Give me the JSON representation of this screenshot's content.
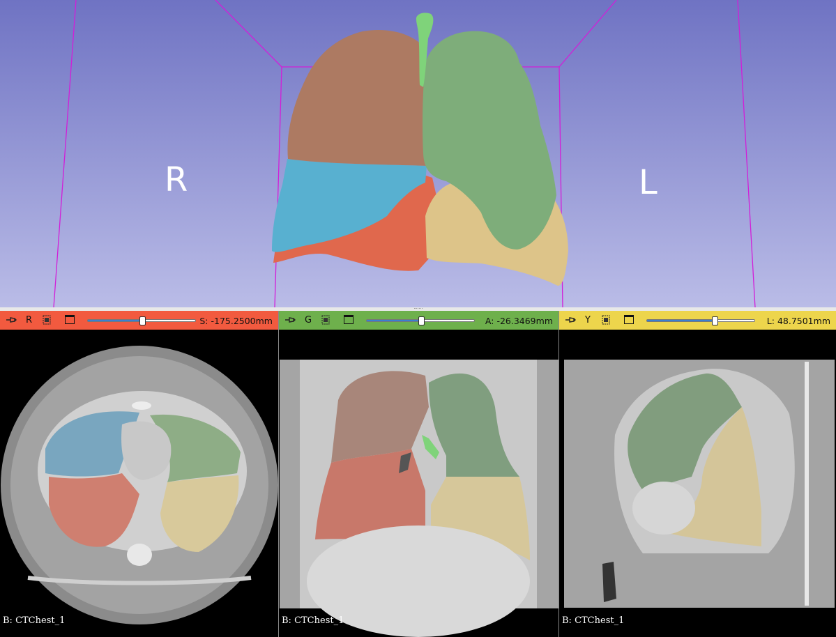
{
  "view3d": {
    "orientation_left": "R",
    "orientation_right": "L",
    "background_top": "#7074c4",
    "background_bottom": "#b9bbe6",
    "segments": {
      "right_upper_lobe": "#b07a62",
      "right_middle_lobe": "#58b1d2",
      "right_lower_lobe": "#e26a4f",
      "left_upper_lobe": "#7eae7a",
      "left_lower_lobe": "#dcc489",
      "airways": "#7fd47a"
    }
  },
  "slices": [
    {
      "id": "red",
      "letter": "R",
      "color": "#f25a3f",
      "offset": "S: -175.2500mm",
      "slider_value": 0.5,
      "caption": "B: CTChest_1"
    },
    {
      "id": "green",
      "letter": "G",
      "color": "#6eb04c",
      "offset": "A: -26.3469mm",
      "slider_value": 0.5,
      "caption": "B: CTChest_1"
    },
    {
      "id": "yellow",
      "letter": "Y",
      "color": "#edd54c",
      "offset": "L: 48.7501mm",
      "slider_value": 0.62,
      "caption": "B: CTChest_1"
    }
  ]
}
